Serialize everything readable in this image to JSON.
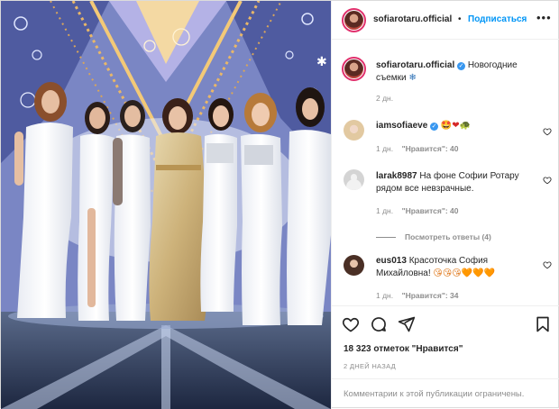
{
  "post": {
    "author": "sofiarotaru.official",
    "follow_label": "Подписаться",
    "separator": "•",
    "caption_text": "Новогодние съемки",
    "caption_emoji": "❄",
    "caption_age": "2 дн.",
    "likes_text": "18 323 отметок \"Нравится\"",
    "date_text": "2 ДНЕЙ НАЗАД",
    "comments_disabled": "Комментарии к этой публикации ограничены."
  },
  "comments": [
    {
      "username": "iamsofiaeve",
      "text": "",
      "emoji": "🤩❤🐢",
      "age": "1 дн.",
      "likes": "\"Нравится\": 40",
      "avatar": "av-blonde"
    },
    {
      "username": "larak8987",
      "text": "На фоне Софии Ротару рядом все невзрачные.",
      "emoji": "",
      "age": "1 дн.",
      "likes": "\"Нравится\": 40",
      "avatar": "av-gray",
      "replies": "Посмотреть ответы (4)"
    },
    {
      "username": "eus013",
      "text": "Красоточка София Михайловна!",
      "emoji": "😘😘😘🧡🧡🧡",
      "age": "1 дн.",
      "likes": "\"Нравится\": 34",
      "avatar": "av-brown"
    }
  ],
  "icons": {
    "more": "more-options-icon",
    "heart": "heart-outline-icon",
    "comment": "comment-bubble-icon",
    "share": "paper-plane-icon",
    "save": "bookmark-icon",
    "verified": "verified-badge-icon",
    "snowflake": "snowflake-icon"
  },
  "colors": {
    "link": "#0095f6",
    "verified": "#3897f0",
    "muted": "#8e8e8e",
    "text": "#262626",
    "border": "#efefef"
  }
}
